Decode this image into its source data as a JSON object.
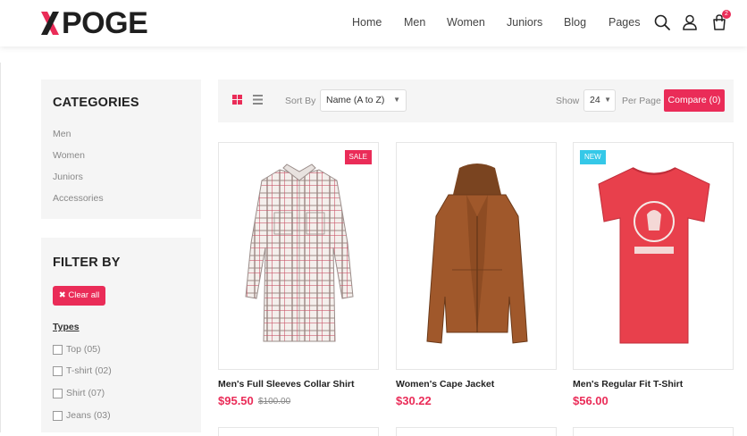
{
  "header": {
    "logo_letter": "X",
    "logo_rest": "POGE",
    "nav": [
      "Home",
      "Men",
      "Women",
      "Juniors",
      "Blog",
      "Pages"
    ],
    "cart_count": "2",
    "icons": [
      "search-icon",
      "user-icon",
      "cart-icon"
    ]
  },
  "sidebar": {
    "categories_title": "CATEGORIES",
    "categories": [
      "Men",
      "Women",
      "Juniors",
      "Accessories"
    ],
    "filter_title": "FILTER BY",
    "clear_all": "Clear all",
    "types_label": "Types",
    "types": [
      "Top (05)",
      "T-shirt (02)",
      "Shirt (07)",
      "Jeans (03)"
    ]
  },
  "toolbar": {
    "sort_by_label": "Sort By",
    "sort_value": "Name (A to Z)",
    "show_label": "Show",
    "show_value": "24",
    "per_page_label": "Per Page",
    "compare_label": "Compare (0)"
  },
  "products": [
    {
      "name": "Men's Full Sleeves Collar Shirt",
      "price": "$95.50",
      "old_price": "$100.00",
      "tag": "SALE"
    },
    {
      "name": "Women's Cape Jacket",
      "price": "$30.22",
      "old_price": "",
      "tag": ""
    },
    {
      "name": "Men's Regular Fit T-Shirt",
      "price": "$56.00",
      "old_price": "",
      "tag": "NEW"
    }
  ],
  "colors": {
    "accent": "#ea2c58",
    "new_tag": "#35c8e8",
    "panel": "#f5f5f5"
  }
}
